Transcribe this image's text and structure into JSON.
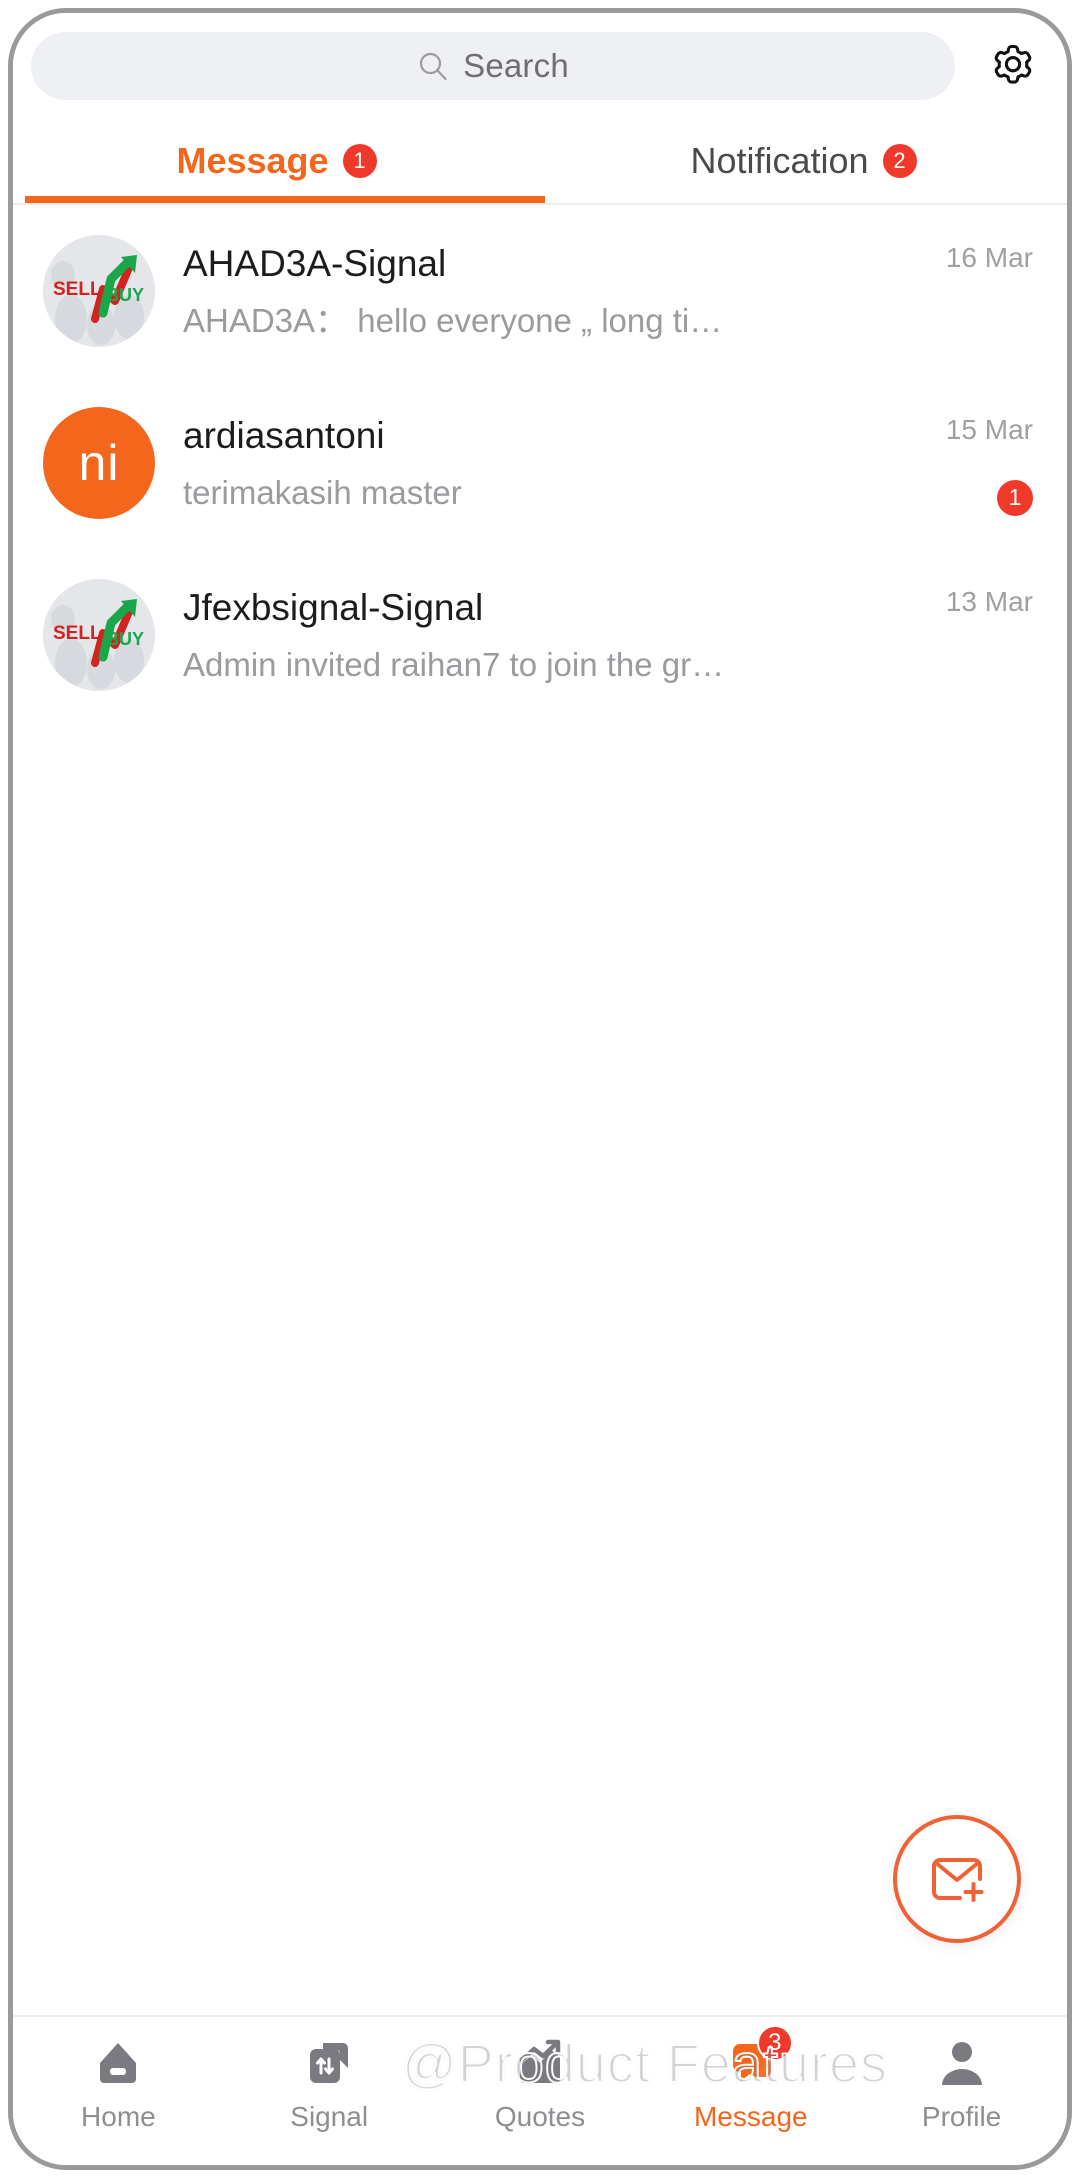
{
  "search": {
    "placeholder": "Search",
    "icon": "search-icon"
  },
  "settings": {
    "icon": "gear-icon"
  },
  "tabs": [
    {
      "label": "Message",
      "badge": "1",
      "active": true
    },
    {
      "label": "Notification",
      "badge": "2",
      "active": false
    }
  ],
  "colors": {
    "accent": "#f4661b",
    "badge_red": "#f0392b",
    "fab_border": "#ef6236",
    "title_text": "#1c1c1e",
    "secondary_text": "#9b9b9f",
    "nav_inactive": "#8e8e93",
    "search_bg": "#eef0f3",
    "avatar_orange": "#f4661b",
    "avatar_gray": "#e2e4e7",
    "sell_red": "#d32222",
    "buy_green": "#1aa64b"
  },
  "messages": [
    {
      "avatar_type": "signal-logo",
      "avatar_text_left": "SELL",
      "avatar_text_right": "BUY",
      "title": "AHAD3A-Signal",
      "preview_sender": "AHAD3A：",
      "preview_text": "hello everyone „ long ti…",
      "date": "16 Mar",
      "unread": ""
    },
    {
      "avatar_type": "initials",
      "avatar_initials": "ni",
      "title": "ardiasantoni",
      "preview_sender": "",
      "preview_text": "terimakasih master",
      "date": "15 Mar",
      "unread": "1"
    },
    {
      "avatar_type": "signal-logo",
      "avatar_text_left": "SELL",
      "avatar_text_right": "BUY",
      "title": "Jfexbsignal-Signal",
      "preview_sender": "",
      "preview_text": "Admin invited raihan7 to join the gr…",
      "date": "13 Mar",
      "unread": ""
    }
  ],
  "compose_fab": {
    "icon": "mail-plus-icon"
  },
  "bottom_nav": [
    {
      "label": "Home",
      "icon": "home-icon",
      "badge": "",
      "active": false
    },
    {
      "label": "Signal",
      "icon": "signal-icon",
      "badge": "",
      "active": false
    },
    {
      "label": "Quotes",
      "icon": "quotes-icon",
      "badge": "",
      "active": false
    },
    {
      "label": "Message",
      "icon": "message-icon",
      "badge": "3",
      "active": true
    },
    {
      "label": "Profile",
      "icon": "profile-icon",
      "badge": "",
      "active": false
    }
  ],
  "watermark": {
    "text": "@Product Features"
  }
}
